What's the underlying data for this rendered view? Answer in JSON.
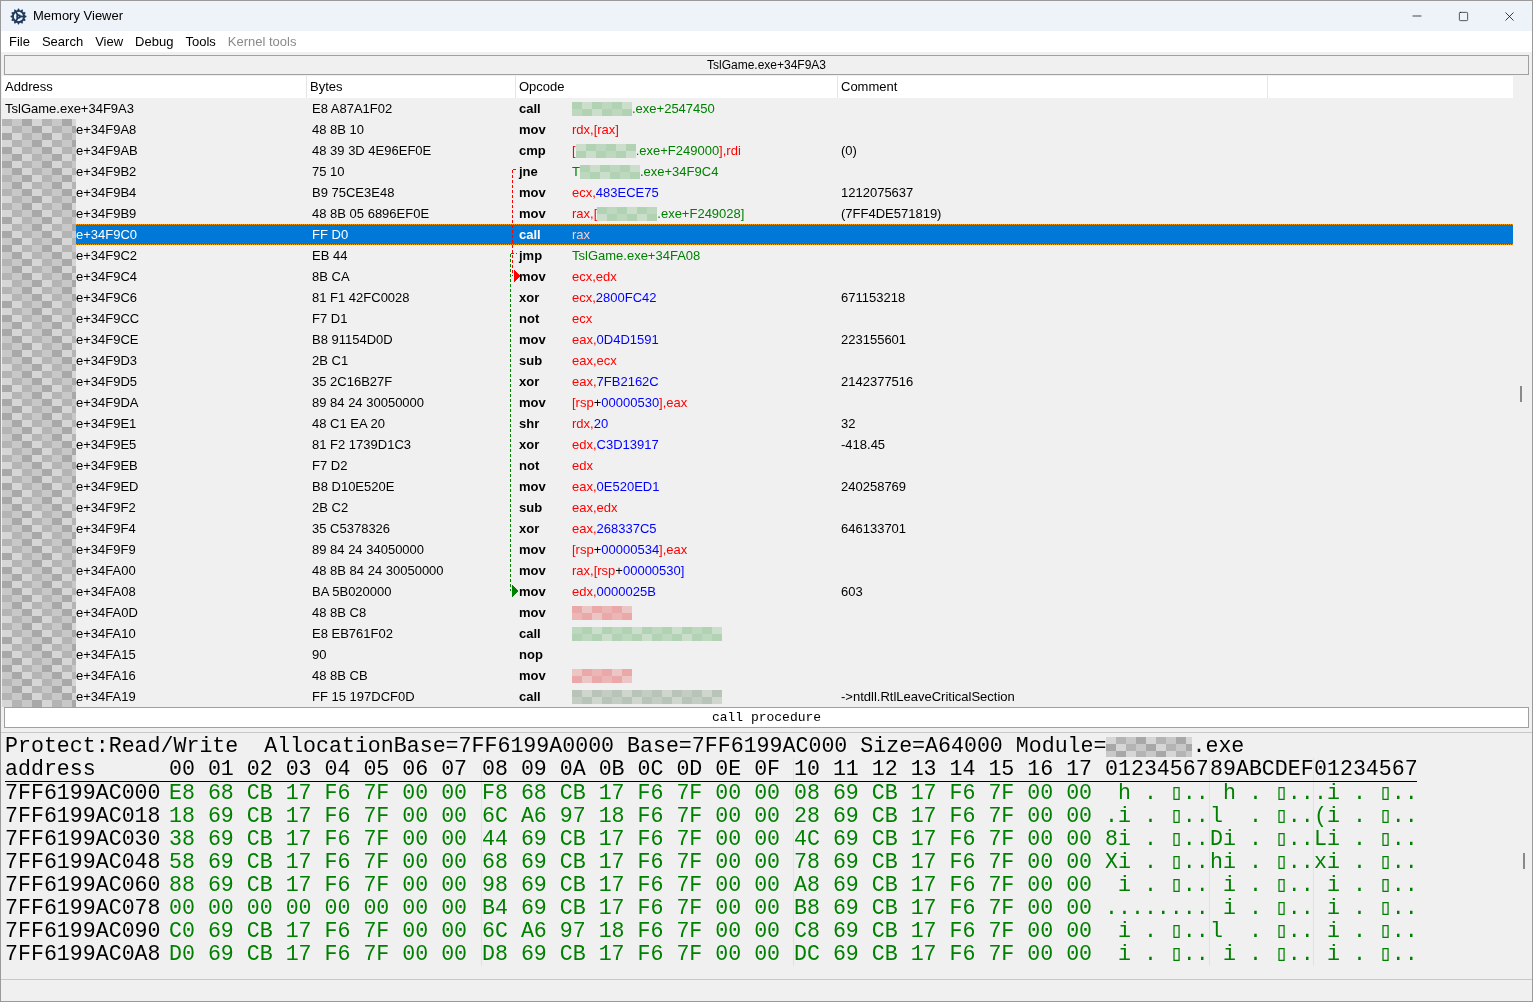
{
  "window": {
    "title": "Memory Viewer"
  },
  "menu": [
    {
      "label": "File",
      "disabled": false
    },
    {
      "label": "Search",
      "disabled": false
    },
    {
      "label": "View",
      "disabled": false
    },
    {
      "label": "Debug",
      "disabled": false
    },
    {
      "label": "Tools",
      "disabled": false
    },
    {
      "label": "Kernel tools",
      "disabled": true
    }
  ],
  "address_bar": "TslGame.exe+34F9A3",
  "columns": [
    "Address",
    "Bytes",
    "Opcode",
    "Comment"
  ],
  "rows": [
    {
      "address": "TslGame.exe+34F9A3",
      "redacted": false,
      "selected": false,
      "bytes": "E8 A87A1F02",
      "opcode": "call",
      "operands": [
        {
          "kind": "blur",
          "color": "#b2d2b4"
        },
        {
          "kind": "sym",
          "t": ".exe+2547450"
        }
      ]
    },
    {
      "address": "e+34F9A8",
      "redacted": true,
      "selected": false,
      "bytes": "48 8B 10",
      "opcode": "mov",
      "operands": [
        {
          "kind": "reg",
          "t": "rdx,[rax]"
        }
      ]
    },
    {
      "address": "e+34F9AB",
      "redacted": true,
      "selected": false,
      "bytes": "48 39 3D 4E96EF0E",
      "opcode": "cmp",
      "operands": [
        {
          "kind": "reg",
          "t": "["
        },
        {
          "kind": "blur",
          "color": "#b2d2b4"
        },
        {
          "kind": "sym",
          "t": ".exe+F249000"
        },
        {
          "kind": "reg",
          "t": "],rdi"
        }
      ],
      "comment": "(0)"
    },
    {
      "address": "e+34F9B2",
      "redacted": true,
      "selected": false,
      "bytes": "75 10",
      "opcode": "jne",
      "operands": [
        {
          "kind": "sym",
          "t": "T"
        },
        {
          "kind": "blur",
          "color": "#b2d2b4"
        },
        {
          "kind": "sym",
          "t": ".exe+34F9C4"
        }
      ],
      "jump": {
        "kind": "source",
        "color": "#ff0000"
      }
    },
    {
      "address": "e+34F9B4",
      "redacted": true,
      "selected": false,
      "bytes": "B9 75CE3E48",
      "opcode": "mov",
      "operands": [
        {
          "kind": "reg",
          "t": "ecx,"
        },
        {
          "kind": "num",
          "t": "483ECE75"
        }
      ],
      "comment": "1212075637"
    },
    {
      "address": "e+34F9B9",
      "redacted": true,
      "selected": false,
      "bytes": "48 8B 05 6896EF0E",
      "opcode": "mov",
      "operands": [
        {
          "kind": "reg",
          "t": "rax,["
        },
        {
          "kind": "blur",
          "color": "#b2d2b4"
        },
        {
          "kind": "sym",
          "t": ".exe+F249028]"
        }
      ],
      "comment": "(7FF4DE571819)"
    },
    {
      "address": "e+34F9C0",
      "redacted": true,
      "selected": true,
      "bytes": "FF D0",
      "opcode": "call",
      "operands": [
        {
          "kind": "reg",
          "t": "rax"
        }
      ]
    },
    {
      "address": "e+34F9C2",
      "redacted": true,
      "selected": false,
      "bytes": "EB 44",
      "opcode": "jmp",
      "operands": [
        {
          "kind": "sym",
          "t": "TslGame.exe+34FA08"
        }
      ],
      "jump": {
        "kind": "source",
        "color": "#008000"
      }
    },
    {
      "address": "e+34F9C4",
      "redacted": true,
      "selected": false,
      "bytes": "8B CA",
      "opcode": "mov",
      "operands": [
        {
          "kind": "reg",
          "t": "ecx,edx"
        }
      ],
      "jump": {
        "kind": "target",
        "color": "#ff0000"
      }
    },
    {
      "address": "e+34F9C6",
      "redacted": true,
      "selected": false,
      "bytes": "81 F1 42FC0028",
      "opcode": "xor",
      "operands": [
        {
          "kind": "reg",
          "t": "ecx,"
        },
        {
          "kind": "num",
          "t": "2800FC42"
        }
      ],
      "comment": "671153218"
    },
    {
      "address": "e+34F9CC",
      "redacted": true,
      "selected": false,
      "bytes": "F7 D1",
      "opcode": "not",
      "operands": [
        {
          "kind": "reg",
          "t": "ecx"
        }
      ]
    },
    {
      "address": "e+34F9CE",
      "redacted": true,
      "selected": false,
      "bytes": "B8 91154D0D",
      "opcode": "mov",
      "operands": [
        {
          "kind": "reg",
          "t": "eax,"
        },
        {
          "kind": "num",
          "t": "0D4D1591"
        }
      ],
      "comment": "223155601"
    },
    {
      "address": "e+34F9D3",
      "redacted": true,
      "selected": false,
      "bytes": "2B C1",
      "opcode": "sub",
      "operands": [
        {
          "kind": "reg",
          "t": "eax,ecx"
        }
      ]
    },
    {
      "address": "e+34F9D5",
      "redacted": true,
      "selected": false,
      "bytes": "35 2C16B27F",
      "opcode": "xor",
      "operands": [
        {
          "kind": "reg",
          "t": "eax,"
        },
        {
          "kind": "num",
          "t": "7FB2162C"
        }
      ],
      "comment": "2142377516"
    },
    {
      "address": "e+34F9DA",
      "redacted": true,
      "selected": false,
      "bytes": "89 84 24 30050000",
      "opcode": "mov",
      "operands": [
        {
          "kind": "reg",
          "t": "[rsp"
        },
        {
          "kind": "plain",
          "t": "+"
        },
        {
          "kind": "num",
          "t": "00000530"
        },
        {
          "kind": "reg",
          "t": "],eax"
        }
      ]
    },
    {
      "address": "e+34F9E1",
      "redacted": true,
      "selected": false,
      "bytes": "48 C1 EA 20",
      "opcode": "shr",
      "operands": [
        {
          "kind": "reg",
          "t": "rdx,"
        },
        {
          "kind": "num",
          "t": "20"
        }
      ],
      "comment": "32"
    },
    {
      "address": "e+34F9E5",
      "redacted": true,
      "selected": false,
      "bytes": "81 F2 1739D1C3",
      "opcode": "xor",
      "operands": [
        {
          "kind": "reg",
          "t": "edx,"
        },
        {
          "kind": "num",
          "t": "C3D13917"
        }
      ],
      "comment": "-418.45"
    },
    {
      "address": "e+34F9EB",
      "redacted": true,
      "selected": false,
      "bytes": "F7 D2",
      "opcode": "not",
      "operands": [
        {
          "kind": "reg",
          "t": "edx"
        }
      ]
    },
    {
      "address": "e+34F9ED",
      "redacted": true,
      "selected": false,
      "bytes": "B8 D10E520E",
      "opcode": "mov",
      "operands": [
        {
          "kind": "reg",
          "t": "eax,"
        },
        {
          "kind": "num",
          "t": "0E520ED1"
        }
      ],
      "comment": "240258769"
    },
    {
      "address": "e+34F9F2",
      "redacted": true,
      "selected": false,
      "bytes": "2B C2",
      "opcode": "sub",
      "operands": [
        {
          "kind": "reg",
          "t": "eax,edx"
        }
      ]
    },
    {
      "address": "e+34F9F4",
      "redacted": true,
      "selected": false,
      "bytes": "35 C5378326",
      "opcode": "xor",
      "operands": [
        {
          "kind": "reg",
          "t": "eax,"
        },
        {
          "kind": "num",
          "t": "268337C5"
        }
      ],
      "comment": "646133701"
    },
    {
      "address": "e+34F9F9",
      "redacted": true,
      "selected": false,
      "bytes": "89 84 24 34050000",
      "opcode": "mov",
      "operands": [
        {
          "kind": "reg",
          "t": "[rsp"
        },
        {
          "kind": "plain",
          "t": "+"
        },
        {
          "kind": "num",
          "t": "00000534"
        },
        {
          "kind": "reg",
          "t": "],eax"
        }
      ]
    },
    {
      "address": "e+34FA00",
      "redacted": true,
      "selected": false,
      "bytes": "48 8B 84 24 30050000",
      "opcode": "mov",
      "operands": [
        {
          "kind": "reg",
          "t": "rax,[rsp"
        },
        {
          "kind": "plain",
          "t": "+"
        },
        {
          "kind": "num",
          "t": "00000530]"
        }
      ]
    },
    {
      "address": "e+34FA08",
      "redacted": true,
      "selected": false,
      "bytes": "BA 5B020000",
      "opcode": "mov",
      "operands": [
        {
          "kind": "reg",
          "t": "edx,"
        },
        {
          "kind": "num",
          "t": "0000025B"
        }
      ],
      "comment": "603",
      "jump": {
        "kind": "target",
        "color": "#008000"
      }
    },
    {
      "address": "e+34FA0D",
      "redacted": true,
      "selected": false,
      "bytes": "48 8B C8",
      "opcode": "mov",
      "operands": [
        {
          "kind": "blur",
          "color": "#eaa8a8"
        }
      ]
    },
    {
      "address": "e+34FA10",
      "redacted": true,
      "selected": false,
      "bytes": "E8 EB761F02",
      "opcode": "call",
      "operands": [
        {
          "kind": "wide_blur",
          "color": "#b2d2b4"
        }
      ]
    },
    {
      "address": "e+34FA15",
      "redacted": true,
      "selected": false,
      "bytes": "90",
      "opcode": "nop",
      "operands": []
    },
    {
      "address": "e+34FA16",
      "redacted": true,
      "selected": false,
      "bytes": "48 8B CB",
      "opcode": "mov",
      "operands": [
        {
          "kind": "blur",
          "color": "#eaa8a8"
        }
      ]
    },
    {
      "address": "e+34FA19",
      "redacted": true,
      "selected": false,
      "bytes": "FF 15 197DCF0D",
      "opcode": "call",
      "operands": [
        {
          "kind": "wide_blur",
          "color": "#b8c4b8"
        }
      ],
      "comment": "->ntdll.RtlLeaveCriticalSection"
    }
  ],
  "status_field": "call procedure",
  "hex": {
    "info": "Protect:Read/Write  AllocationBase=7FF6199A0000 Base=7FF6199AC000 Size=A64000 Module=",
    "module_suffix": ".exe",
    "address_header": "address",
    "column_groups": [
      "00 01 02 03 04 05 06 07",
      "08 09 0A 0B 0C 0D 0E 0F",
      "10 11 12 13 14 15 16 17"
    ],
    "ascii_header": [
      "01234567",
      "89ABCDEF",
      "01234567"
    ],
    "rows": [
      {
        "address": "7FF6199AC000",
        "bytes": [
          "E8 68 CB 17 F6 7F 00 00",
          "F8 68 CB 17 F6 7F 00 00",
          "08 69 CB 17 F6 7F 00 00"
        ],
        "ascii": [
          " h . ▯..",
          " h . ▯..",
          ".i . ▯.."
        ]
      },
      {
        "address": "7FF6199AC018",
        "bytes": [
          "18 69 CB 17 F6 7F 00 00",
          "6C A6 97 18 F6 7F 00 00",
          "28 69 CB 17 F6 7F 00 00"
        ],
        "ascii": [
          ".i . ▯..",
          "l  . ▯..",
          "(i . ▯.."
        ]
      },
      {
        "address": "7FF6199AC030",
        "bytes": [
          "38 69 CB 17 F6 7F 00 00",
          "44 69 CB 17 F6 7F 00 00",
          "4C 69 CB 17 F6 7F 00 00"
        ],
        "ascii": [
          "8i . ▯..",
          "Di . ▯..",
          "Li . ▯.."
        ]
      },
      {
        "address": "7FF6199AC048",
        "bytes": [
          "58 69 CB 17 F6 7F 00 00",
          "68 69 CB 17 F6 7F 00 00",
          "78 69 CB 17 F6 7F 00 00"
        ],
        "ascii": [
          "Xi . ▯..",
          "hi . ▯..",
          "xi . ▯.."
        ]
      },
      {
        "address": "7FF6199AC060",
        "bytes": [
          "88 69 CB 17 F6 7F 00 00",
          "98 69 CB 17 F6 7F 00 00",
          "A8 69 CB 17 F6 7F 00 00"
        ],
        "ascii": [
          " i . ▯..",
          " i . ▯..",
          " i . ▯.."
        ]
      },
      {
        "address": "7FF6199AC078",
        "bytes": [
          "00 00 00 00 00 00 00 00",
          "B4 69 CB 17 F6 7F 00 00",
          "B8 69 CB 17 F6 7F 00 00"
        ],
        "ascii": [
          "........",
          " i . ▯..",
          " i . ▯.."
        ]
      },
      {
        "address": "7FF6199AC090",
        "bytes": [
          "C0 69 CB 17 F6 7F 00 00",
          "6C A6 97 18 F6 7F 00 00",
          "C8 69 CB 17 F6 7F 00 00"
        ],
        "ascii": [
          " i . ▯..",
          "l  . ▯..",
          " i . ▯.."
        ]
      },
      {
        "address": "7FF6199AC0A8",
        "bytes": [
          "D0 69 CB 17 F6 7F 00 00",
          "D8 69 CB 17 F6 7F 00 00",
          "DC 69 CB 17 F6 7F 00 00"
        ],
        "ascii": [
          " i . ▯..",
          " i . ▯..",
          " i . ▯.."
        ]
      }
    ]
  }
}
